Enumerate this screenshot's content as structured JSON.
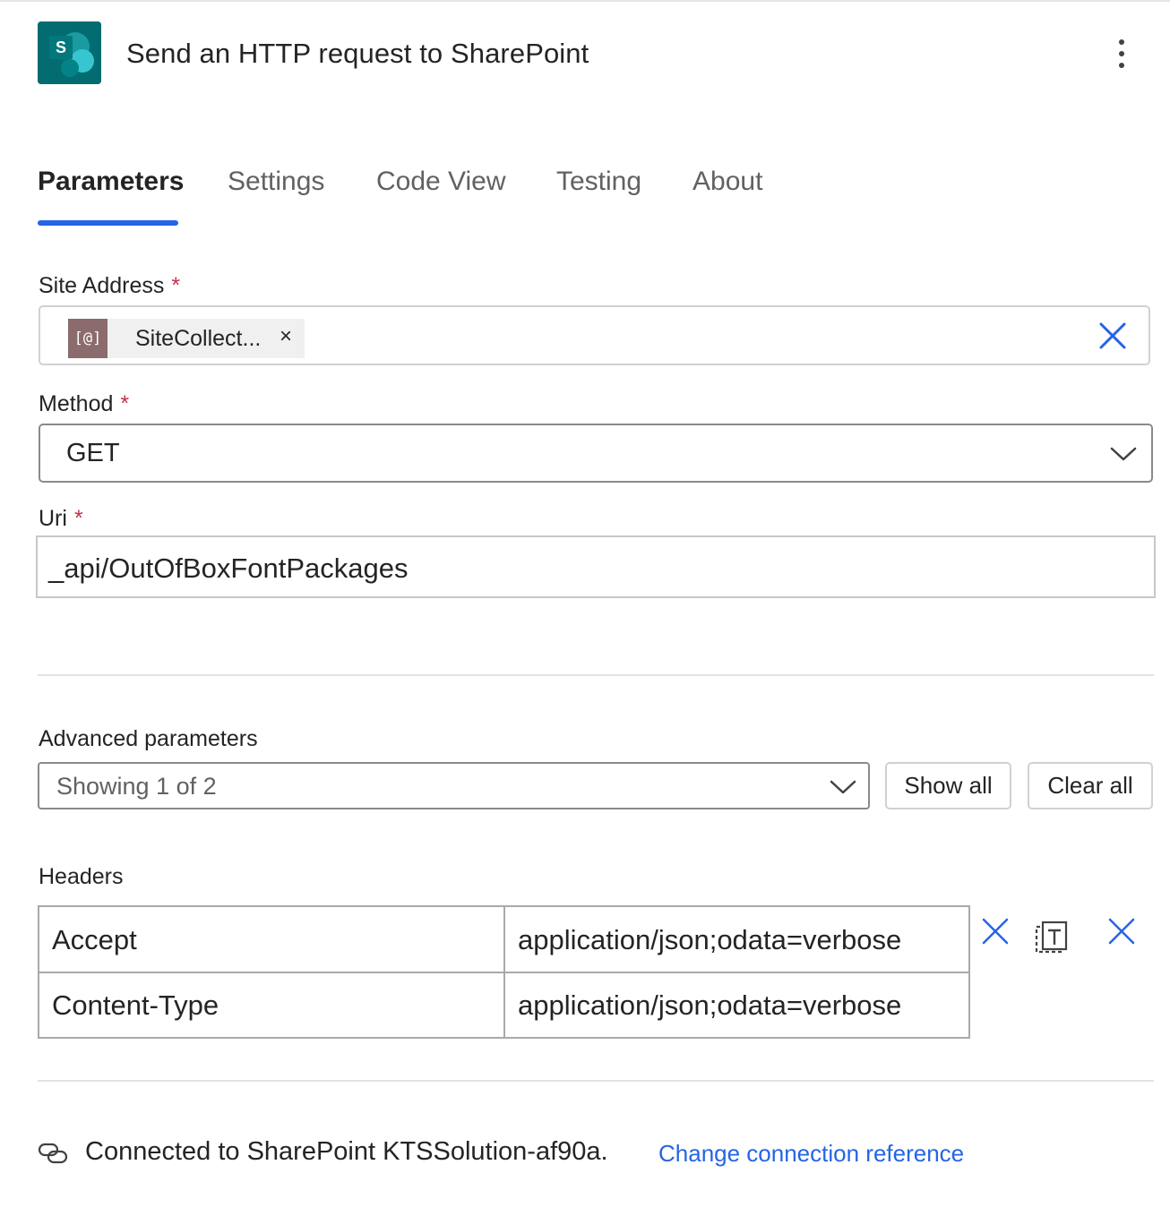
{
  "header": {
    "title": "Send an HTTP request to SharePoint",
    "icon_letter": "S",
    "icon_name": "sharepoint-icon",
    "more_icon": "more-vertical-icon"
  },
  "tabs": [
    {
      "label": "Parameters",
      "active": true
    },
    {
      "label": "Settings",
      "active": false
    },
    {
      "label": "Code View",
      "active": false
    },
    {
      "label": "Testing",
      "active": false
    },
    {
      "label": "About",
      "active": false
    }
  ],
  "fields": {
    "site_address": {
      "label": "Site Address",
      "required_mark": "*",
      "token_icon": "[@]",
      "token_text": "SiteCollect...",
      "token_remove": "×"
    },
    "method": {
      "label": "Method",
      "required_mark": "*",
      "value": "GET"
    },
    "uri": {
      "label": "Uri",
      "required_mark": "*",
      "value": "_api/OutOfBoxFontPackages"
    }
  },
  "advanced": {
    "label": "Advanced parameters",
    "select_value": "Showing 1 of 2",
    "show_all": "Show all",
    "clear_all": "Clear all"
  },
  "headers": {
    "label": "Headers",
    "rows": [
      {
        "key": "Accept",
        "value": "application/json;odata=verbose"
      },
      {
        "key": "Content-Type",
        "value": "application/json;odata=verbose"
      }
    ]
  },
  "connection": {
    "text": "Connected to SharePoint KTSSolution-af90a.",
    "link": "Change connection reference"
  },
  "colors": {
    "accent": "#2564e5",
    "required": "#c4314b",
    "sharepoint": "#036c70",
    "token_icon_bg": "#8b6b6b"
  }
}
